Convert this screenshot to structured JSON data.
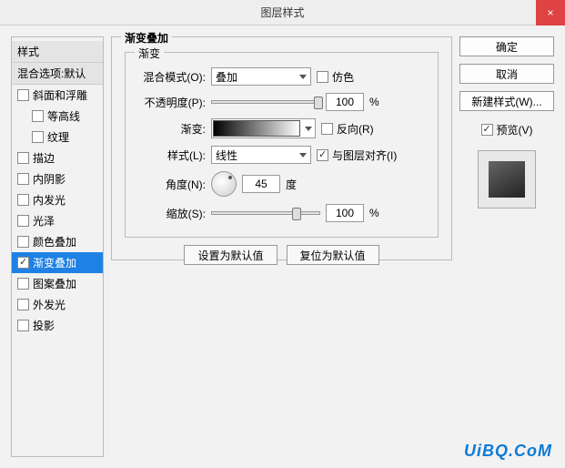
{
  "window": {
    "title": "图层样式",
    "close": "×"
  },
  "left": {
    "header": "样式",
    "blendHeader": "混合选项:默认",
    "items": [
      {
        "label": "斜面和浮雕",
        "checked": false,
        "indent": false
      },
      {
        "label": "等高线",
        "checked": false,
        "indent": true
      },
      {
        "label": "纹理",
        "checked": false,
        "indent": true
      },
      {
        "label": "描边",
        "checked": false,
        "indent": false
      },
      {
        "label": "内阴影",
        "checked": false,
        "indent": false
      },
      {
        "label": "内发光",
        "checked": false,
        "indent": false
      },
      {
        "label": "光泽",
        "checked": false,
        "indent": false
      },
      {
        "label": "颜色叠加",
        "checked": false,
        "indent": false
      },
      {
        "label": "渐变叠加",
        "checked": true,
        "indent": false,
        "selected": true
      },
      {
        "label": "图案叠加",
        "checked": false,
        "indent": false
      },
      {
        "label": "外发光",
        "checked": false,
        "indent": false
      },
      {
        "label": "投影",
        "checked": false,
        "indent": false
      }
    ]
  },
  "center": {
    "groupTitle": "渐变叠加",
    "innerTitle": "渐变",
    "blendMode": {
      "label": "混合模式(O):",
      "value": "叠加"
    },
    "dither": {
      "label": "仿色",
      "checked": false
    },
    "opacity": {
      "label": "不透明度(P):",
      "value": "100",
      "unit": "%"
    },
    "gradient": {
      "label": "渐变:"
    },
    "reverse": {
      "label": "反向(R)",
      "checked": false
    },
    "style": {
      "label": "样式(L):",
      "value": "线性"
    },
    "alignLayer": {
      "label": "与图层对齐(I)",
      "checked": true
    },
    "angle": {
      "label": "角度(N):",
      "value": "45",
      "unit": "度"
    },
    "scale": {
      "label": "缩放(S):",
      "value": "100",
      "unit": "%"
    },
    "btnDefault": "设置为默认值",
    "btnReset": "复位为默认值"
  },
  "right": {
    "ok": "确定",
    "cancel": "取消",
    "newStyle": "新建样式(W)...",
    "preview": {
      "label": "预览(V)",
      "checked": true
    }
  },
  "watermark": "UiBQ.CoM"
}
